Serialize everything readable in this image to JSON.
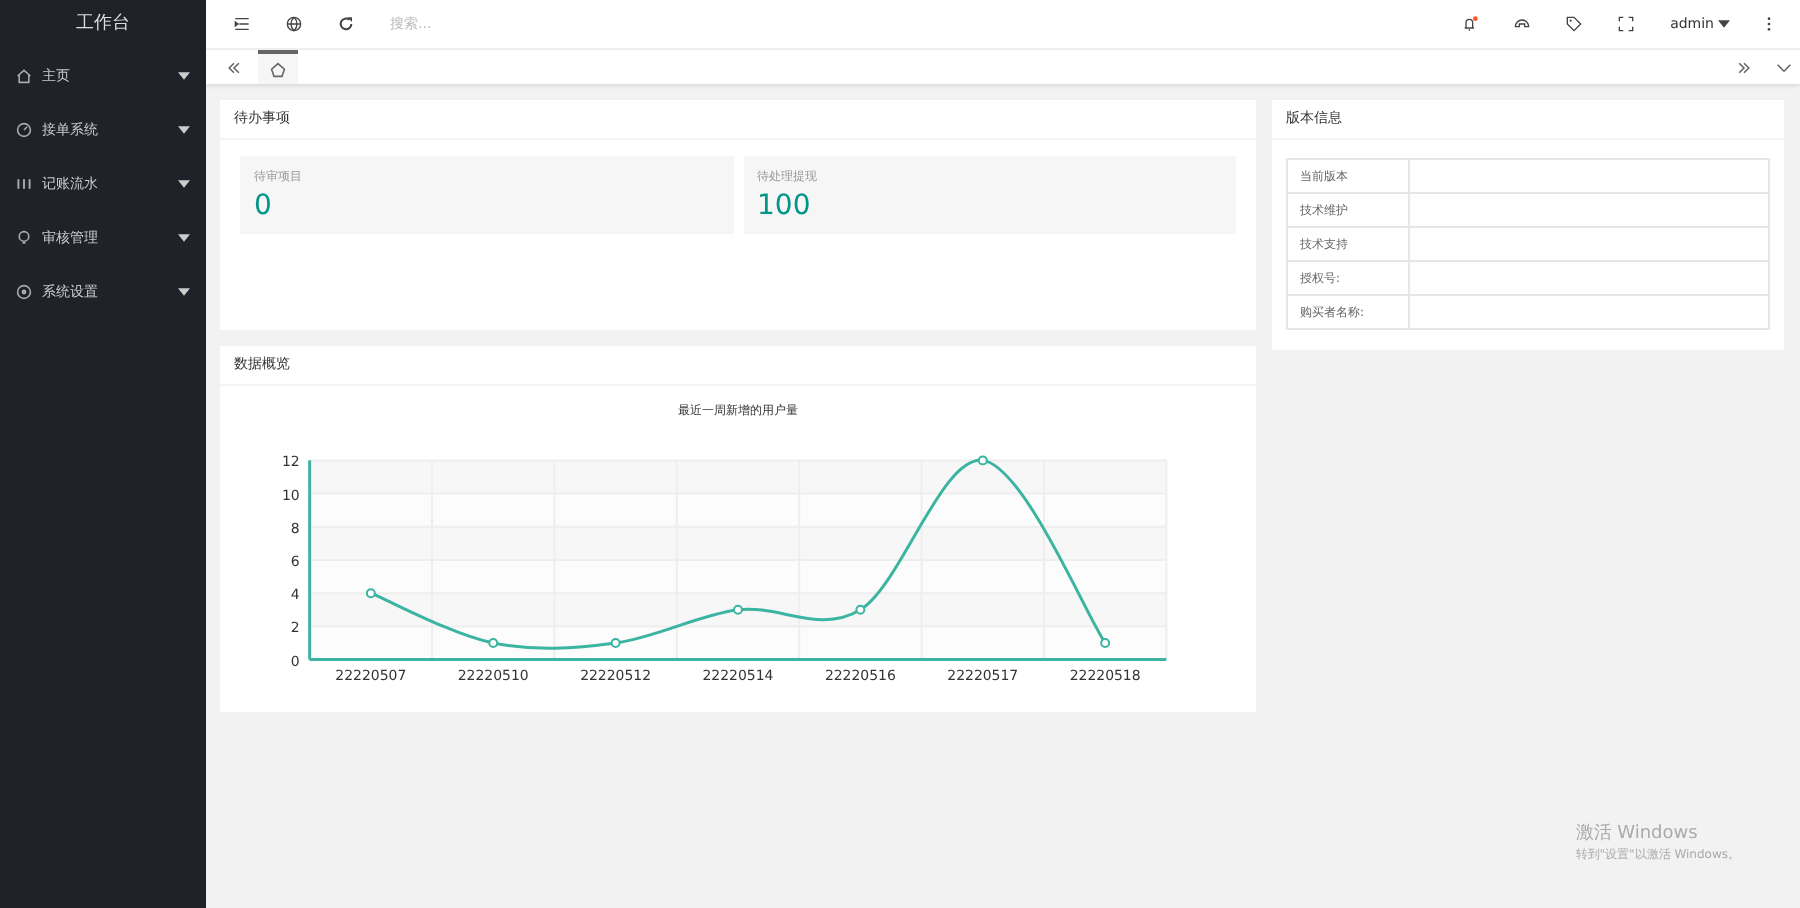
{
  "sidebar": {
    "title": "工作台",
    "items": [
      {
        "label": "主页",
        "expanded": false
      },
      {
        "label": "接单系统",
        "expanded": false
      },
      {
        "label": "记账流水",
        "expanded": false
      },
      {
        "label": "审核管理",
        "expanded": false
      },
      {
        "label": "系统设置",
        "expanded": false
      }
    ]
  },
  "topbar": {
    "search": {
      "placeholder": "搜索..."
    },
    "user": "admin"
  },
  "todo": {
    "title": "待办事项",
    "stats": [
      {
        "label": "待审项目",
        "value": "0"
      },
      {
        "label": "待处理提现",
        "value": "100"
      }
    ]
  },
  "overview": {
    "title": "数据概览",
    "chart_data": {
      "type": "line",
      "title": "最近一周新增的用户量",
      "categories": [
        "22220507",
        "22220510",
        "22220512",
        "22220514",
        "22220516",
        "22220517",
        "22220518"
      ],
      "series": [
        {
          "color": "#3bb4a1",
          "marker": "circle",
          "values": [
            4,
            1,
            1,
            3,
            3,
            12,
            1
          ]
        }
      ],
      "grid": true,
      "ylim": [
        0,
        12
      ],
      "yticks": [
        0,
        2,
        4,
        6,
        8,
        10,
        12
      ]
    }
  },
  "version": {
    "title": "版本信息",
    "rows": [
      {
        "label": "当前版本"
      },
      {
        "label": "技术维护"
      },
      {
        "label": "技术支持"
      },
      {
        "label": "授权号:"
      },
      {
        "label": "购买者名称:"
      }
    ]
  },
  "activation": {
    "title": "激活 Windows",
    "text": "转到\"设置\"以激活 Windows。"
  }
}
